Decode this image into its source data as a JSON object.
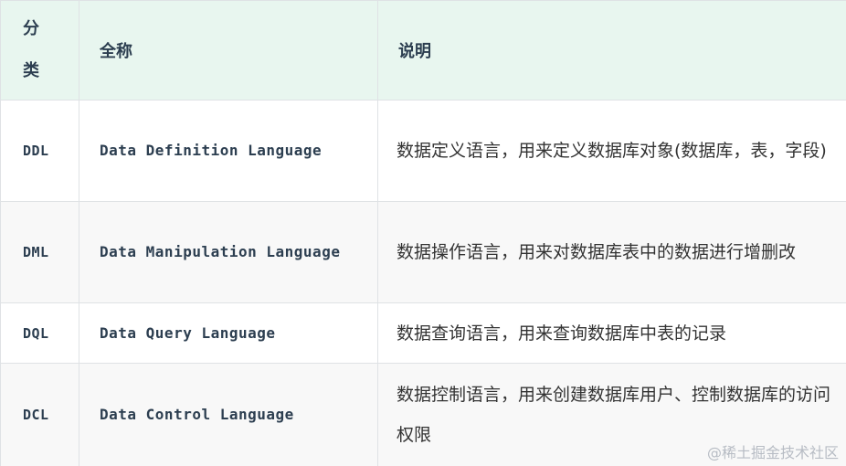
{
  "table": {
    "headers": [
      "分类",
      "全称",
      "说明"
    ],
    "rows": [
      {
        "abbr": "DDL",
        "full": "Data Definition Language",
        "desc": "数据定义语言，用来定义数据库对象(数据库，表，字段)"
      },
      {
        "abbr": "DML",
        "full": "Data Manipulation Language",
        "desc": "数据操作语言，用来对数据库表中的数据进行增删改"
      },
      {
        "abbr": "DQL",
        "full": "Data Query Language",
        "desc": "数据查询语言，用来查询数据库中表的记录"
      },
      {
        "abbr": "DCL",
        "full": "Data Control Language",
        "desc": "数据控制语言，用来创建数据库用户、控制数据库的访问权限"
      }
    ]
  },
  "watermark": "@稀土掘金技术社区"
}
